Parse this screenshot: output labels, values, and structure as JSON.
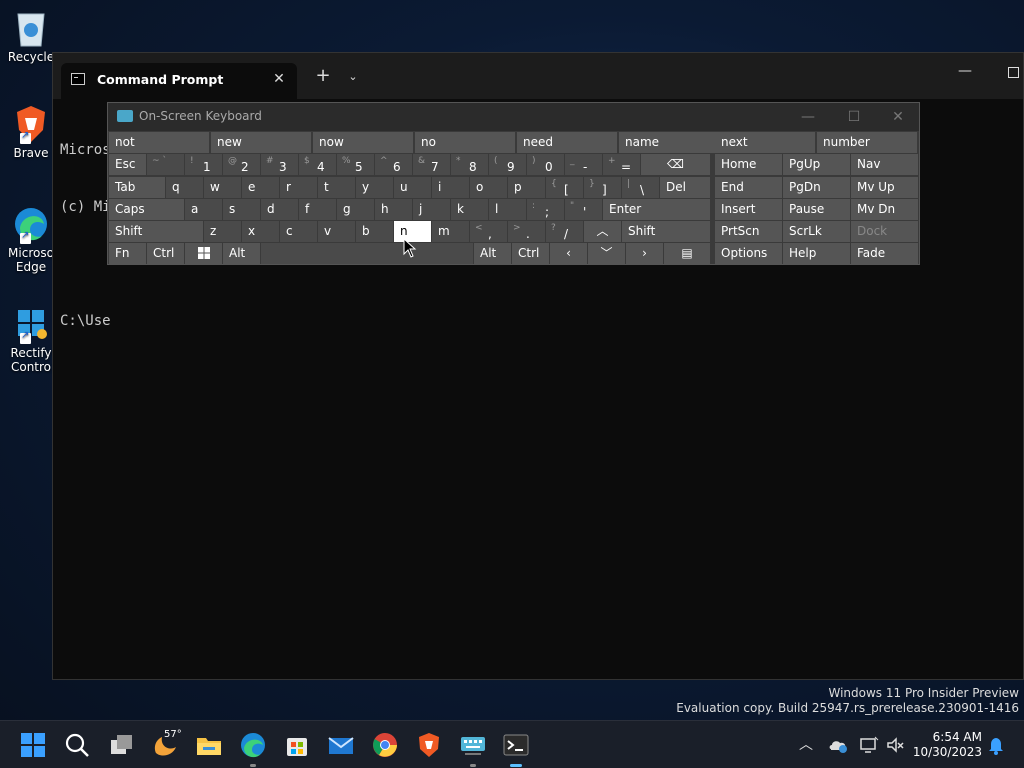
{
  "desktop": {
    "icons": [
      {
        "label": "Recycle"
      },
      {
        "label": "Brave"
      },
      {
        "label": "Microso Edge"
      },
      {
        "label": "Rectify Contro"
      }
    ]
  },
  "cmd": {
    "tab_title": "Command Prompt",
    "close_glyph": "✕",
    "add_glyph": "+",
    "dropdown_glyph": "⌄",
    "minimize_glyph": "—",
    "lines": [
      "Micros",
      "(c) Mi",
      "",
      "C:\\Use"
    ]
  },
  "osk": {
    "title": "On-Screen Keyboard",
    "predictions": [
      "not",
      "new",
      "now",
      "no",
      "need",
      "name",
      "next",
      "number"
    ],
    "row1": [
      {
        "sh": "~ `",
        "pr": ""
      },
      {
        "sh": "!",
        "pr": "1"
      },
      {
        "sh": "@",
        "pr": "2"
      },
      {
        "sh": "#",
        "pr": "3"
      },
      {
        "sh": "$",
        "pr": "4"
      },
      {
        "sh": "%",
        "pr": "5"
      },
      {
        "sh": "^",
        "pr": "6"
      },
      {
        "sh": "&",
        "pr": "7"
      },
      {
        "sh": "*",
        "pr": "8"
      },
      {
        "sh": "(",
        "pr": "9"
      },
      {
        "sh": ")",
        "pr": "0"
      },
      {
        "sh": "_",
        "pr": "-"
      },
      {
        "sh": "+",
        "pr": "="
      }
    ],
    "row2_letters": [
      "q",
      "w",
      "e",
      "r",
      "t",
      "y",
      "u",
      "i",
      "o",
      "p"
    ],
    "row2_sym": [
      {
        "sh": "{",
        "pr": "["
      },
      {
        "sh": "}",
        "pr": "]"
      },
      {
        "sh": "|",
        "pr": "\\"
      }
    ],
    "row3_letters": [
      "a",
      "s",
      "d",
      "f",
      "g",
      "h",
      "j",
      "k",
      "l"
    ],
    "row3_sym": [
      {
        "sh": ":",
        "pr": ";"
      },
      {
        "sh": "\"",
        "pr": "'"
      }
    ],
    "row4_letters": [
      "z",
      "x",
      "c",
      "v",
      "b",
      "n",
      "m"
    ],
    "row4_sym": [
      {
        "sh": "<",
        "pr": ","
      },
      {
        "sh": ">",
        "pr": "."
      },
      {
        "sh": "?",
        "pr": "/"
      }
    ],
    "keys": {
      "esc": "Esc",
      "tab": "Tab",
      "caps": "Caps",
      "shift": "Shift",
      "fn": "Fn",
      "ctrl": "Ctrl",
      "alt": "Alt",
      "del": "Del",
      "enter": "Enter",
      "backspace_glyph": "⌫",
      "up_glyph": "︿",
      "down_glyph": "﹀",
      "left_glyph": "‹",
      "right_glyph": "›",
      "menu_glyph": "▤"
    },
    "nav": [
      [
        "Home",
        "PgUp",
        "Nav"
      ],
      [
        "End",
        "PgDn",
        "Mv Up"
      ],
      [
        "Insert",
        "Pause",
        "Mv Dn"
      ],
      [
        "PrtScn",
        "ScrLk",
        "Dock"
      ],
      [
        "Options",
        "Help",
        "Fade"
      ]
    ]
  },
  "watermark": {
    "line1": "Windows 11 Pro Insider Preview",
    "line2": "Evaluation copy. Build 25947.rs_prerelease.230901-1416"
  },
  "taskbar": {
    "weather_temp": "57°",
    "time": "6:54 AM",
    "date": "10/30/2023",
    "tray_chevron": "︿"
  }
}
